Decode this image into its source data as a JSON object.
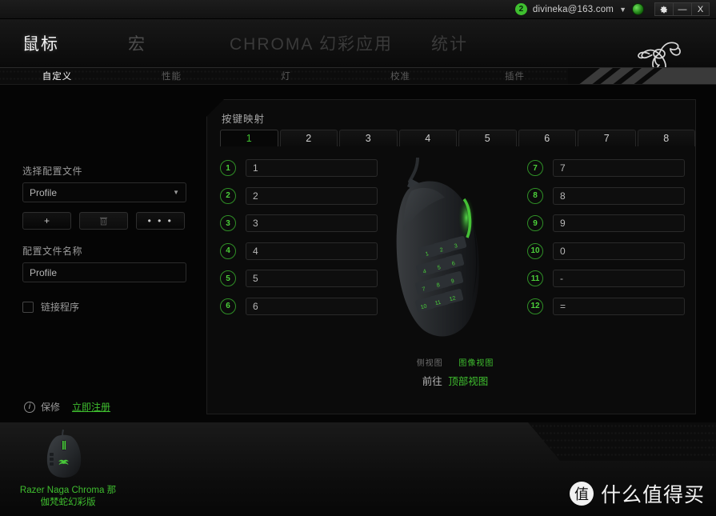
{
  "titlebar": {
    "notification_count": "2",
    "user_email": "divineka@163.com",
    "caret": "▼",
    "globe_icon": "globe-icon",
    "settings_btn": "✿",
    "minimize_btn": "—",
    "close_btn": "X"
  },
  "header": {
    "main_tabs": [
      {
        "label": "鼠标",
        "active": true
      },
      {
        "label": "宏",
        "active": false
      },
      {
        "label": "CHROMA 幻彩应用",
        "active": false
      },
      {
        "label": "统计",
        "active": false
      }
    ],
    "logo": "razer-logo"
  },
  "subtabs": [
    {
      "label": "自定义",
      "active": true
    },
    {
      "label": "性能",
      "active": false
    },
    {
      "label": "灯",
      "active": false
    },
    {
      "label": "校准",
      "active": false
    },
    {
      "label": "插件",
      "active": false
    }
  ],
  "sidebar": {
    "select_profile_label": "选择配置文件",
    "profile_selected": "Profile",
    "profile_caret": "▼",
    "buttons": [
      {
        "name": "add-profile",
        "label": "+"
      },
      {
        "name": "delete-profile",
        "label": "🗑"
      },
      {
        "name": "more-profile",
        "label": "• • •"
      }
    ],
    "profile_name_label": "配置文件名称",
    "profile_name_value": "Profile",
    "link_program_label": "链接程序",
    "link_program_checked": false
  },
  "warranty": {
    "icon": "info-icon",
    "label": "保修",
    "link": "立即注册"
  },
  "panel": {
    "title": "按键映射",
    "number_tabs": [
      {
        "label": "1",
        "active": true
      },
      {
        "label": "2",
        "active": false
      },
      {
        "label": "3",
        "active": false
      },
      {
        "label": "4",
        "active": false
      },
      {
        "label": "5",
        "active": false
      },
      {
        "label": "6",
        "active": false
      },
      {
        "label": "7",
        "active": false
      },
      {
        "label": "8",
        "active": false
      }
    ],
    "mappings_left": [
      {
        "num": "1",
        "value": "1"
      },
      {
        "num": "2",
        "value": "2"
      },
      {
        "num": "3",
        "value": "3"
      },
      {
        "num": "4",
        "value": "4"
      },
      {
        "num": "5",
        "value": "5"
      },
      {
        "num": "6",
        "value": "6"
      }
    ],
    "mappings_right": [
      {
        "num": "7",
        "value": "7"
      },
      {
        "num": "8",
        "value": "8"
      },
      {
        "num": "9",
        "value": "9"
      },
      {
        "num": "10",
        "value": "0"
      },
      {
        "num": "11",
        "value": "-"
      },
      {
        "num": "12",
        "value": "="
      }
    ],
    "mouse_illustration": "razer-naga-side-view",
    "mouse_keypad_labels": [
      "1",
      "2",
      "3",
      "4",
      "5",
      "6",
      "7",
      "8",
      "9",
      "10",
      "11",
      "12"
    ],
    "view_side_label": "侧视图",
    "view_image_label": "图像视图",
    "goto_label": "前往",
    "goto_top_view": "顶部视图"
  },
  "device": {
    "thumbnail": "razer-naga-chroma-thumb",
    "name_line1": "Razer Naga Chroma 那",
    "name_line2": "伽梵蛇幻彩版"
  },
  "watermark": {
    "logo_char": "值",
    "text": "什么值得买"
  },
  "colors": {
    "accent_green": "#3fbf2f",
    "bg_dark": "#070707",
    "panel_bg": "#0b0b0b",
    "text_light": "#cfcfcf"
  }
}
